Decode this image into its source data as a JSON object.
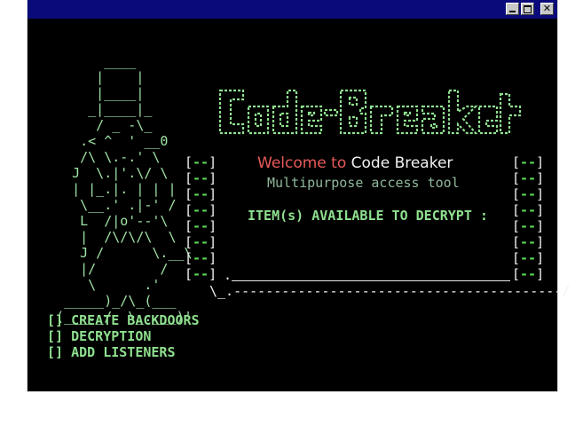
{
  "window": {
    "controls": {
      "minimize": "minimize",
      "maximize": "maximize",
      "close": "✕"
    }
  },
  "ascii_art": {
    "lines": [
      "       ____",
      "      |    |",
      "      |____|",
      "     _|____|_",
      "      / _ -\\_",
      "    .< ^  ' __0",
      "    /\\ \\.-.' \\",
      "   J  \\.|'.\\/ \\",
      "   | |_.|. | | |",
      "    \\__.' .|-' /",
      "    L  /|o'--'\\",
      "    |  /\\/\\/\\  \\",
      "    J /      \\.__\\",
      "    |/        /",
      "     \\      .'",
      "  _____)_/\\_(___",
      " (___._/  \\_.___)'"
    ]
  },
  "left_brackets": [
    "[--]",
    "[--]",
    "[--]",
    "[--]",
    "[--]",
    "[--]",
    "[--]",
    "[--]"
  ],
  "right_brackets": [
    "[--]",
    "[--]",
    "[--]",
    "[--]",
    "[--]",
    "[--]",
    "[--]",
    "[--]"
  ],
  "logo": {
    "text": "CodeBreaker",
    "color": "#8fe08f"
  },
  "welcome": {
    "part1": "Welcome to",
    "part2": "Code Breaker"
  },
  "subtitle": "Multipurpose access tool",
  "items_label": "ITEM(s) AVAILABLE TO DECRYPT :",
  "underline_start": ".",
  "dashed_line": "\\_.-----------------------------------------/",
  "menu": {
    "items": [
      "[] CREATE BACKDOORS",
      "[] DECRYPTION",
      "[] ADD LISTENERS"
    ]
  },
  "colors": {
    "background": "#000000",
    "titlebar": "#0a0a7a",
    "accent_green": "#8fe08f",
    "welcome_red": "#e85a5a"
  }
}
